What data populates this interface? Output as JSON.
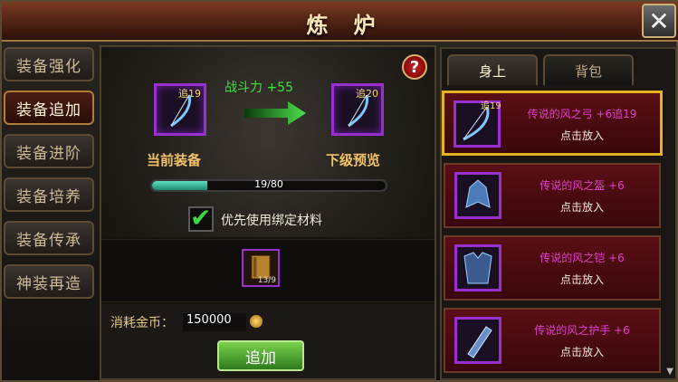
{
  "title": "炼炉",
  "close_icon": "close-icon",
  "left_tabs": [
    {
      "label": "装备强化",
      "active": false
    },
    {
      "label": "装备追加",
      "active": true
    },
    {
      "label": "装备进阶",
      "active": false
    },
    {
      "label": "装备培养",
      "active": false
    },
    {
      "label": "装备传承",
      "active": false
    },
    {
      "label": "神装再造",
      "active": false
    }
  ],
  "center": {
    "help_icon": "?",
    "current": {
      "level": "追19",
      "label": "当前装备"
    },
    "next": {
      "level": "追20",
      "label": "下级预览"
    },
    "power_text": "战斗力 +55",
    "progress": {
      "text": "19/80",
      "value": 19,
      "max": 80
    },
    "bind_option": {
      "label": "优先使用绑定材料",
      "checked": true
    },
    "material": {
      "count": "13/9"
    },
    "cost": {
      "label": "消耗金币：",
      "value": "150000"
    },
    "add_button": "追加"
  },
  "right": {
    "tabs": [
      {
        "label": "身上",
        "active": true
      },
      {
        "label": "背包",
        "active": false
      }
    ],
    "items": [
      {
        "level": "追19",
        "name": "传说的风之弓 +6追19",
        "hint": "点击放入",
        "selected": true
      },
      {
        "level": "",
        "name": "传说的风之盔 +6",
        "hint": "点击放入",
        "selected": false
      },
      {
        "level": "",
        "name": "传说的风之铠 +6",
        "hint": "点击放入",
        "selected": false
      },
      {
        "level": "",
        "name": "传说的风之护手 +6",
        "hint": "点击放入",
        "selected": false
      }
    ]
  }
}
